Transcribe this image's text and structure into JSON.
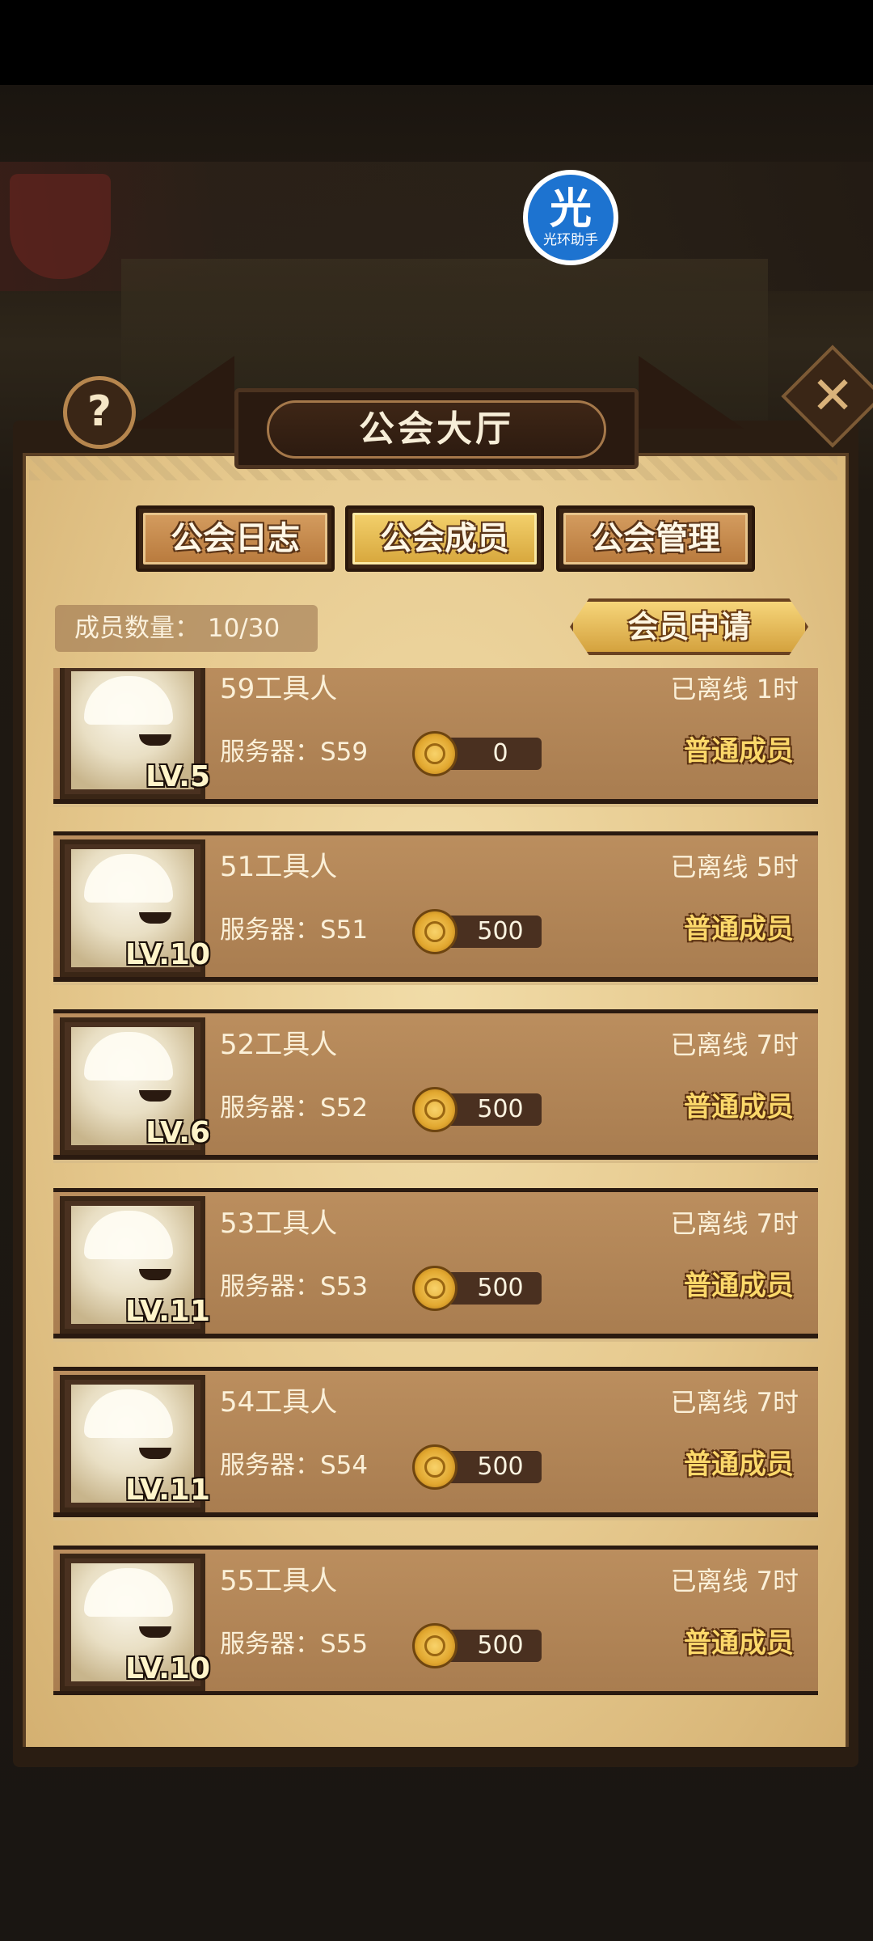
{
  "helper": {
    "glyph": "光",
    "label": "光环助手"
  },
  "panel": {
    "title": "公会大厅"
  },
  "help_icon": "question-icon",
  "close_icon": "close-icon",
  "tabs": [
    {
      "label": "公会日志",
      "active": false
    },
    {
      "label": "公会成员",
      "active": true
    },
    {
      "label": "公会管理",
      "active": false
    }
  ],
  "member_count": "成员数量： 10/30",
  "apply_button": "会员申请",
  "members": [
    {
      "name": "59工具人",
      "offline": "已离线 1时",
      "level": "LV.5",
      "server": "服务器：S59",
      "contribution": "0",
      "role": "普通成员"
    },
    {
      "name": "51工具人",
      "offline": "已离线 5时",
      "level": "LV.10",
      "server": "服务器：S51",
      "contribution": "500",
      "role": "普通成员"
    },
    {
      "name": "52工具人",
      "offline": "已离线 7时",
      "level": "LV.6",
      "server": "服务器：S52",
      "contribution": "500",
      "role": "普通成员"
    },
    {
      "name": "53工具人",
      "offline": "已离线 7时",
      "level": "LV.11",
      "server": "服务器：S53",
      "contribution": "500",
      "role": "普通成员"
    },
    {
      "name": "54工具人",
      "offline": "已离线 7时",
      "level": "LV.11",
      "server": "服务器：S54",
      "contribution": "500",
      "role": "普通成员"
    },
    {
      "name": "55工具人",
      "offline": "已离线 7时",
      "level": "LV.10",
      "server": "服务器：S55",
      "contribution": "500",
      "role": "普通成员"
    }
  ]
}
